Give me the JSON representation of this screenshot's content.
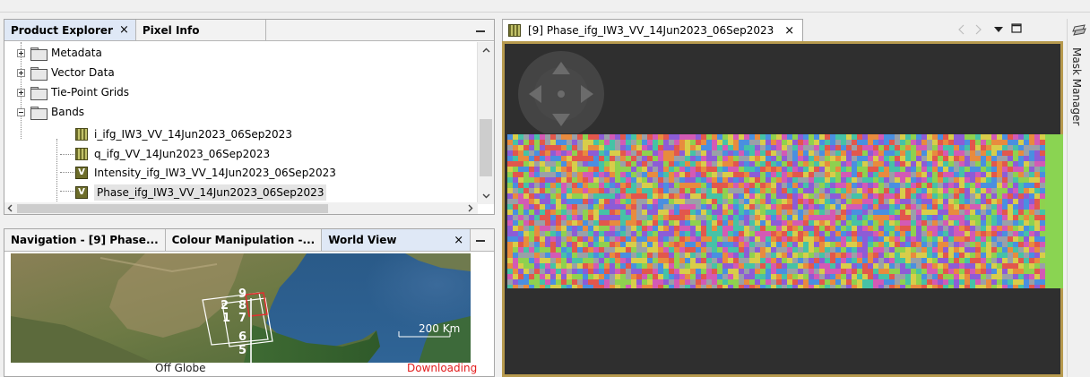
{
  "product_explorer": {
    "tabs": [
      {
        "label": "Product Explorer",
        "close": "×"
      },
      {
        "label": "Pixel Info"
      }
    ],
    "tree": {
      "metadata": "Metadata",
      "vector_data": "Vector Data",
      "tie_point_grids": "Tie-Point Grids",
      "bands": "Bands",
      "band_items": [
        "i_ifg_IW3_VV_14Jun2023_06Sep2023",
        "q_ifg_VV_14Jun2023_06Sep2023",
        "Intensity_ifg_IW3_VV_14Jun2023_06Sep2023",
        "Phase_ifg_IW3_VV_14Jun2023_06Sep2023"
      ],
      "band_icon_letters": [
        "V",
        "V"
      ]
    }
  },
  "world_view_panel": {
    "tabs": [
      {
        "label": "Navigation - [9] Phase..."
      },
      {
        "label": "Colour Manipulation -..."
      },
      {
        "label": "World View",
        "close": "×"
      }
    ],
    "map": {
      "footprint_numbers": [
        "9",
        "2",
        "8",
        "1",
        "7",
        "6",
        "5"
      ],
      "scale_label": "200 Km"
    },
    "status": {
      "left": "Off Globe",
      "right": "Downloading"
    }
  },
  "image_view": {
    "tab_label": "[9] Phase_ifg_IW3_VV_14Jun2023_06Sep2023",
    "tab_close": "×"
  },
  "mask_manager": {
    "label": "Mask Manager"
  },
  "colors": {
    "selection_frame": "#b79a4e",
    "canvas_background": "#2f2f2f",
    "green_edge": "#8ad452",
    "downloading": "#e21b1b"
  }
}
